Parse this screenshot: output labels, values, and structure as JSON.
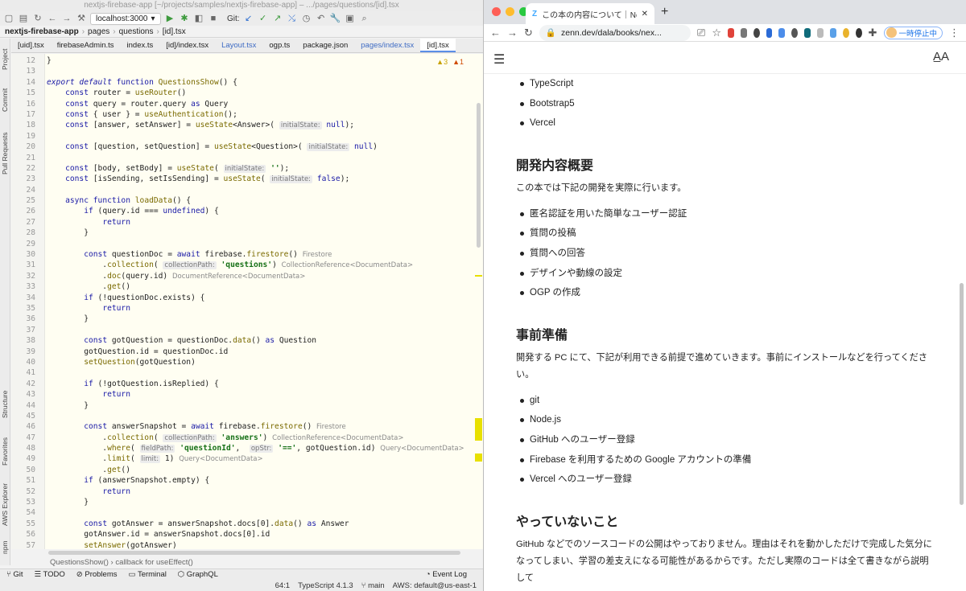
{
  "ide": {
    "window_title": "nextjs-firebase-app [~/projects/samples/nextjs-firebase-app] – .../pages/questions/[id].tsx",
    "run_config": "localhost:3000",
    "git_label": "Git:",
    "breadcrumb": [
      "nextjs-firebase-app",
      "pages",
      "questions",
      "[id].tsx"
    ],
    "tabs": [
      {
        "label": "[uid].tsx",
        "modified": false,
        "active": false
      },
      {
        "label": "firebaseAdmin.ts",
        "modified": false,
        "active": false
      },
      {
        "label": "index.ts",
        "modified": false,
        "active": false
      },
      {
        "label": "[id]/index.tsx",
        "modified": false,
        "active": false
      },
      {
        "label": "Layout.tsx",
        "modified": true,
        "active": false
      },
      {
        "label": "ogp.ts",
        "modified": false,
        "active": false
      },
      {
        "label": "package.json",
        "modified": false,
        "active": false
      },
      {
        "label": "pages/index.tsx",
        "modified": true,
        "active": false
      },
      {
        "label": "[id].tsx",
        "modified": false,
        "active": true
      }
    ],
    "side_tools": [
      "Project",
      "Commit",
      "Pull Requests",
      "Structure",
      "Favorites",
      "AWS Explorer",
      "npm"
    ],
    "warnings": {
      "warn": "▲3",
      "err": "▲1"
    },
    "code_lines": [
      {
        "no": "12",
        "html": "}"
      },
      {
        "no": "13",
        "html": ""
      },
      {
        "no": "14",
        "html": "<span class=\"it\">export default</span> <span class=\"kw\">function</span> <span class=\"fn\">QuestionsShow</span>() {"
      },
      {
        "no": "15",
        "html": "    <span class=\"kw\">const</span> router = <span class=\"fn\">useRouter</span>()"
      },
      {
        "no": "16",
        "html": "    <span class=\"kw\">const</span> query = router.query <span class=\"kw\">as</span> Query"
      },
      {
        "no": "17",
        "html": "    <span class=\"kw\">const</span> { user } = <span class=\"fn\">useAuthentication</span>();"
      },
      {
        "no": "18",
        "html": "    <span class=\"kw\">const</span> [answer, setAnswer] = <span class=\"fn\">useState</span>&lt;Answer&gt;( <span class=\"hint\">initialState:</span> <span class=\"kw\">null</span>);"
      },
      {
        "no": "19",
        "html": ""
      },
      {
        "no": "20",
        "html": "    <span class=\"kw\">const</span> [question, setQuestion] = <span class=\"fn\">useState</span>&lt;Question&gt;( <span class=\"hint\">initialState:</span> <span class=\"kw\">null</span>)"
      },
      {
        "no": "21",
        "html": ""
      },
      {
        "no": "22",
        "html": "    <span class=\"kw\">const</span> [body, setBody] = <span class=\"fn\">useState</span>( <span class=\"hint\">initialState:</span> <span class=\"str\">''</span>);"
      },
      {
        "no": "23",
        "html": "    <span class=\"kw\">const</span> [isSending, setIsSending] = <span class=\"fn\">useState</span>( <span class=\"hint\">initialState:</span> <span class=\"kw\">false</span>);"
      },
      {
        "no": "24",
        "html": ""
      },
      {
        "no": "25",
        "html": "    <span class=\"kw\">async function</span> <span class=\"fn\">loadData</span>() {"
      },
      {
        "no": "26",
        "html": "        <span class=\"kw\">if</span> (query.id === <span class=\"kw\">undefined</span>) {"
      },
      {
        "no": "27",
        "html": "            <span class=\"kw\">return</span>"
      },
      {
        "no": "28",
        "html": "        }"
      },
      {
        "no": "29",
        "html": ""
      },
      {
        "no": "30",
        "html": "        <span class=\"kw\">const</span> questionDoc = <span class=\"kw\">await</span> firebase.<span class=\"fn\">firestore</span>() <span class=\"ghost\">Firestore</span>"
      },
      {
        "no": "31",
        "html": "            .<span class=\"fn\">collection</span>( <span class=\"hint\">collectionPath:</span> <span class=\"str\">'questions'</span>) <span class=\"ghost\">CollectionReference&lt;DocumentData&gt;</span>"
      },
      {
        "no": "32",
        "html": "            .<span class=\"fn\">doc</span>(query.id) <span class=\"ghost\">DocumentReference&lt;DocumentData&gt;</span>"
      },
      {
        "no": "33",
        "html": "            .<span class=\"fn\">get</span>()"
      },
      {
        "no": "34",
        "html": "        <span class=\"kw\">if</span> (!questionDoc.exists) {"
      },
      {
        "no": "35",
        "html": "            <span class=\"kw\">return</span>"
      },
      {
        "no": "36",
        "html": "        }"
      },
      {
        "no": "37",
        "html": ""
      },
      {
        "no": "38",
        "html": "        <span class=\"kw\">const</span> gotQuestion = questionDoc.<span class=\"fn\">data</span>() <span class=\"kw\">as</span> Question"
      },
      {
        "no": "39",
        "html": "        gotQuestion.id = questionDoc.id"
      },
      {
        "no": "40",
        "html": "        <span class=\"fn\">setQuestion</span>(gotQuestion)"
      },
      {
        "no": "41",
        "html": ""
      },
      {
        "no": "42",
        "html": "        <span class=\"kw\">if</span> (!gotQuestion.isReplied) {"
      },
      {
        "no": "43",
        "html": "            <span class=\"kw\">return</span>"
      },
      {
        "no": "44",
        "html": "        }"
      },
      {
        "no": "45",
        "html": ""
      },
      {
        "no": "46",
        "html": "        <span class=\"kw\">const</span> answerSnapshot = <span class=\"kw\">await</span> firebase.<span class=\"fn\">firestore</span>() <span class=\"ghost\">Firestore</span>"
      },
      {
        "no": "47",
        "html": "            .<span class=\"fn\">collection</span>( <span class=\"hint\">collectionPath:</span> <span class=\"str\">'answers'</span>) <span class=\"ghost\">CollectionReference&lt;DocumentData&gt;</span>"
      },
      {
        "no": "48",
        "html": "            .<span class=\"fn\">where</span>( <span class=\"hint\">fieldPath:</span> <span class=\"str\">'questionId'</span>,  <span class=\"hint\">opStr:</span> <span class=\"str\">'=='</span>, gotQuestion.id) <span class=\"ghost\">Query&lt;DocumentData&gt;</span>"
      },
      {
        "no": "49",
        "html": "            .<span class=\"fn\">limit</span>( <span class=\"hint\">limit:</span> 1) <span class=\"ghost\">Query&lt;DocumentData&gt;</span>"
      },
      {
        "no": "50",
        "html": "            .<span class=\"fn\">get</span>()"
      },
      {
        "no": "51",
        "html": "        <span class=\"kw\">if</span> (answerSnapshot.empty) {"
      },
      {
        "no": "52",
        "html": "            <span class=\"kw\">return</span>"
      },
      {
        "no": "53",
        "html": "        }"
      },
      {
        "no": "54",
        "html": ""
      },
      {
        "no": "55",
        "html": "        <span class=\"kw\">const</span> gotAnswer = answerSnapshot.docs[0].<span class=\"fn\">data</span>() <span class=\"kw\">as</span> Answer"
      },
      {
        "no": "56",
        "html": "        gotAnswer.id = answerSnapshot.docs[0].id"
      },
      {
        "no": "57",
        "html": "        <span class=\"fn\">setAnswer</span>(gotAnswer)"
      }
    ],
    "code_breadcrumb": [
      "QuestionsShow()",
      "callback for useEffect()"
    ],
    "bottom_tools": [
      "Git",
      "TODO",
      "Problems",
      "Terminal",
      "GraphQL"
    ],
    "event_log": "Event Log",
    "status": {
      "position": "64:1",
      "language": "TypeScript 4.1.3",
      "branch": "main",
      "aws": "AWS: default@us-east-1"
    }
  },
  "browser": {
    "tab_title": "この本の内容について｜Next.jsと",
    "url": "zenn.dev/dala/books/nex...",
    "pause_label": "一時停止中",
    "content": {
      "list1": [
        "TypeScript",
        "Bootstrap5",
        "Vercel"
      ],
      "h_overview": "開発内容概要",
      "p_overview": "この本では下記の開発を実際に行います。",
      "list2": [
        "匿名認証を用いた簡単なユーザー認証",
        "質問の投稿",
        "質問への回答",
        "デザインや動線の設定",
        "OGP の作成"
      ],
      "h_prep": "事前準備",
      "p_prep": "開発する PC にて、下記が利用できる前提で進めていきます。事前にインストールなどを行ってください。",
      "list3": [
        "git",
        "Node.js",
        "GitHub へのユーザー登録",
        "Firebase を利用するための Google アカウントの準備",
        "Vercel へのユーザー登録"
      ],
      "h_not": "やっていないこと",
      "p_not": "GitHub などでのソースコードの公開はやっておりません。理由はそれを動かしただけで完成した気分になってしまい、学習の差支えになる可能性があるからです。ただし実際のコードは全て書きながら説明して"
    }
  }
}
